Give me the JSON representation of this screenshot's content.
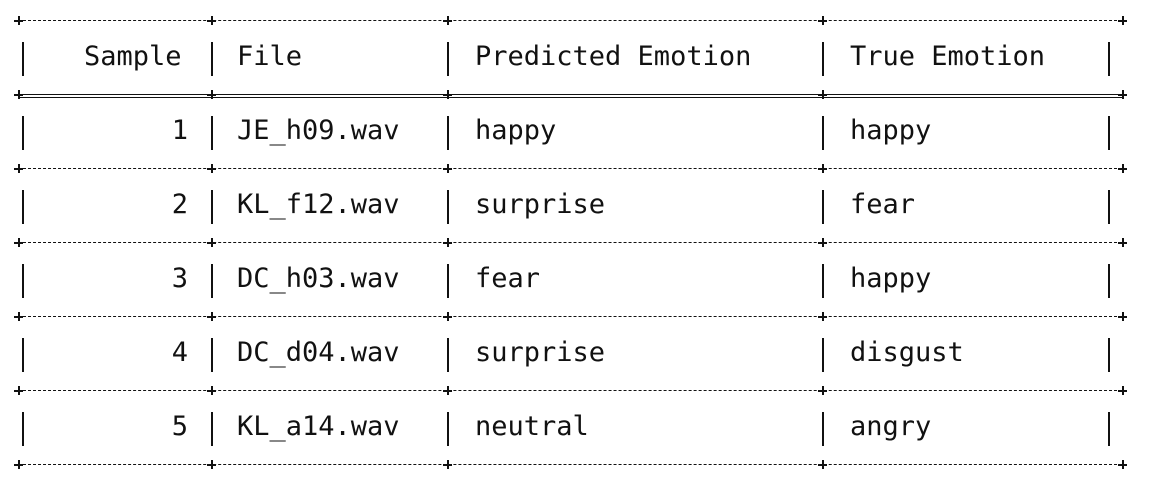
{
  "table": {
    "headers": [
      "Sample",
      "File",
      "Predicted Emotion",
      "True Emotion"
    ],
    "rows": [
      {
        "sample": "1",
        "file": "JE_h09.wav",
        "predicted": "happy",
        "true": "happy"
      },
      {
        "sample": "2",
        "file": "KL_f12.wav",
        "predicted": "surprise",
        "true": "fear"
      },
      {
        "sample": "3",
        "file": "DC_h03.wav",
        "predicted": "fear",
        "true": "happy"
      },
      {
        "sample": "4",
        "file": "DC_d04.wav",
        "predicted": "surprise",
        "true": "disgust"
      },
      {
        "sample": "5",
        "file": "KL_a14.wav",
        "predicted": "neutral",
        "true": "angry"
      }
    ]
  }
}
